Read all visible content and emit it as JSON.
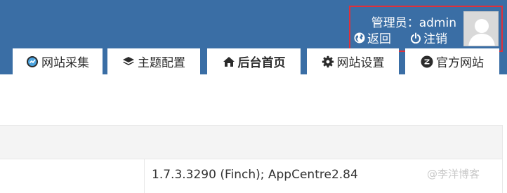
{
  "header": {
    "admin_label": "管理员：admin",
    "back_label": "返回",
    "logout_label": "注销",
    "avatar_icon": "default-user-avatar-icon",
    "highlight_color": "#e0303a",
    "brand_color": "#3a6ea5"
  },
  "tabs": [
    {
      "label": "网站采集",
      "icon": "collect-icon"
    },
    {
      "label": "主题配置",
      "icon": "layers-icon"
    },
    {
      "label": "后台首页",
      "icon": "home-icon",
      "active": true
    },
    {
      "label": "网站设置",
      "icon": "gear-icon"
    },
    {
      "label": "官方网站",
      "icon": "z-logo-icon"
    }
  ],
  "table": {
    "version_value": "1.7.3.3290 (Finch); AppCentre2.84"
  },
  "watermark": "@李洋博客"
}
